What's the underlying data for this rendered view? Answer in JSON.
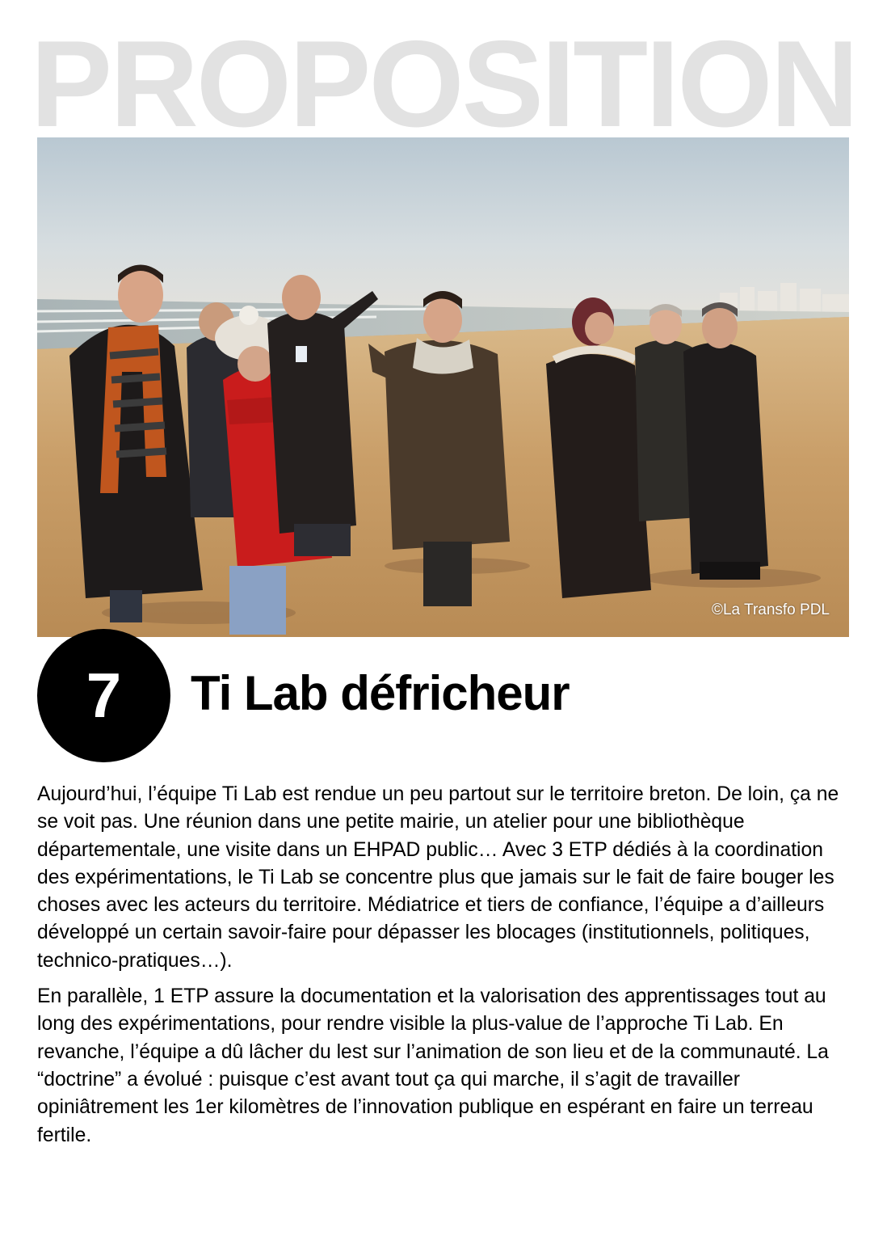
{
  "header": {
    "word": "PROPOSITION"
  },
  "photo": {
    "credit": "©La Transfo PDL"
  },
  "proposal": {
    "number": "7",
    "title": "Ti Lab défricheur"
  },
  "paragraphs": [
    "Aujourd’hui, l’équipe Ti Lab est rendue un peu partout sur le territoire breton. De loin, ça ne se voit pas. Une réunion dans une petite mairie, un atelier pour une bibliothèque départementale, une visite dans un EHPAD public… Avec 3 ETP dédiés à la coordination des expérimentations, le Ti Lab se concentre plus que jamais sur le fait de faire bouger les choses avec les acteurs du territoire. Médiatrice et tiers de confiance, l’équipe a d’ailleurs développé un certain savoir-faire pour dépasser les blocages (institutionnels, politiques, technico-pratiques…).",
    "En parallèle, 1 ETP assure la documentation et la valorisation des apprentissages tout au long des expérimentations, pour rendre visible la plus-value de l’approche Ti Lab. En revanche, l’équipe a dû lâcher du lest sur l’animation de son lieu et de la communauté. La “doctrine” a évolué : puisque c’est avant tout ça qui marche, il s’agit de travailler opiniâtrement les 1er kilomètres de l’innovation publique en espérant en faire un terreau fertile."
  ]
}
